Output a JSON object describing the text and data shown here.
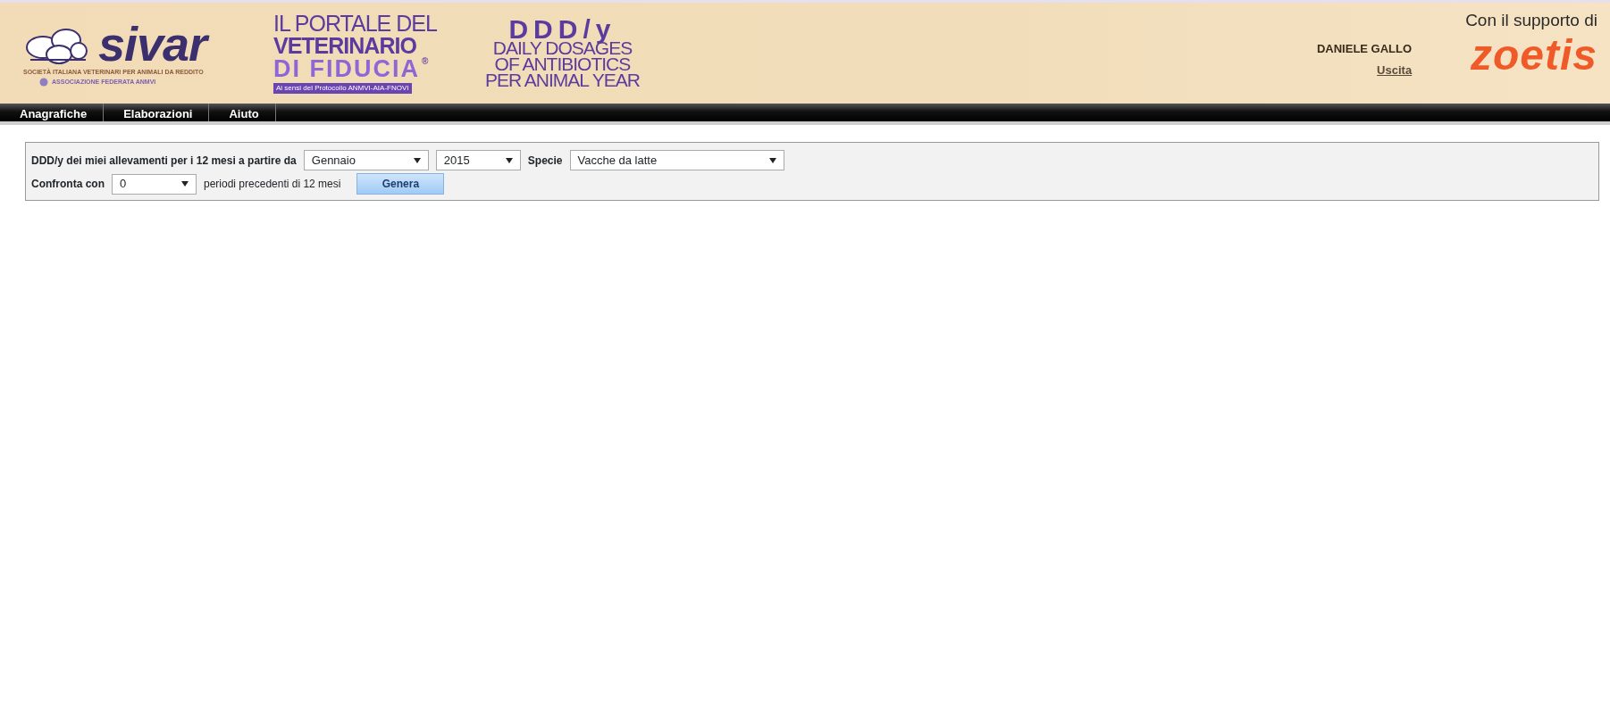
{
  "header": {
    "sivar_logo": {
      "name": "sivar",
      "subtitle": "SOCIETÀ ITALIANA VETERINARI PER ANIMALI DA REDDITO",
      "association": "ASSOCIAZIONE FEDERATA ANMVI"
    },
    "portal_logo": {
      "line_1": "IL PORTALE DEL",
      "line_2": "VETERINARIO",
      "line_3": "DI FIDUCIA",
      "mark": "®",
      "caption": "Ai sensi del Protocollo ANMVI-AIA-FNOVI"
    },
    "ddd_logo": {
      "title": "DDD/y",
      "lines": [
        "DAILY DOSAGES",
        "OF ANTIBIOTICS",
        "PER ANIMAL YEAR"
      ]
    },
    "user": {
      "name": "DANIELE GALLO",
      "logout": "Uscita"
    },
    "sponsor": {
      "caption": "Con il supporto di",
      "name": "zoetis"
    }
  },
  "menu": [
    {
      "label": "Anagrafiche"
    },
    {
      "label": "Elaborazioni"
    },
    {
      "label": "Aiuto"
    }
  ],
  "form": {
    "rows": [
      {
        "items": [
          {
            "kind": "label",
            "text": "DDD/y dei miei allevamenti per i 12 mesi a partire da"
          },
          {
            "kind": "select",
            "value": "Gennaio"
          },
          {
            "kind": "select",
            "value": "2015"
          },
          {
            "kind": "label",
            "text": "Specie"
          },
          {
            "kind": "select",
            "value": "Vacche da latte"
          }
        ]
      },
      {
        "items": [
          {
            "kind": "label",
            "text": "Confronta con"
          },
          {
            "kind": "select",
            "value": "0"
          },
          {
            "kind": "text",
            "text": "periodi precedenti di 12 mesi"
          },
          {
            "kind": "button",
            "text": "Genera"
          }
        ]
      }
    ]
  }
}
